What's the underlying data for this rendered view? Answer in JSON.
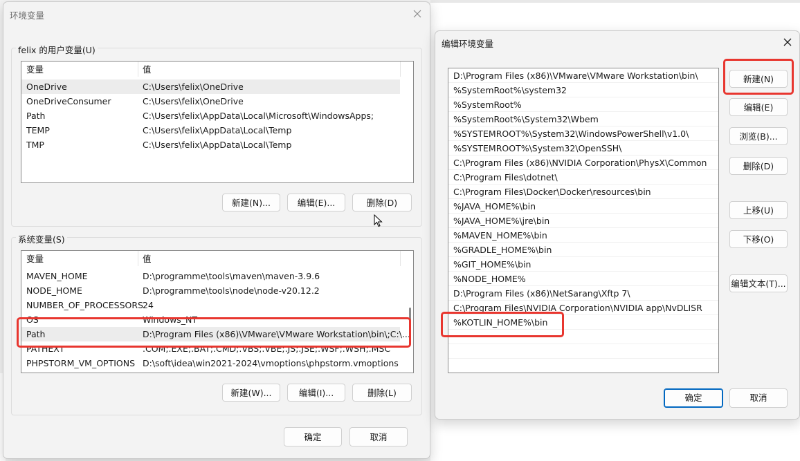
{
  "env_dialog": {
    "title": "环境变量",
    "user_group_label": "felix 的用户变量(U)",
    "user_columns": [
      "变量",
      "值"
    ],
    "user_vars": [
      {
        "name": "OneDrive",
        "value": "C:\\Users\\felix\\OneDrive"
      },
      {
        "name": "OneDriveConsumer",
        "value": "C:\\Users\\felix\\OneDrive"
      },
      {
        "name": "Path",
        "value": "C:\\Users\\felix\\AppData\\Local\\Microsoft\\WindowsApps;"
      },
      {
        "name": "TEMP",
        "value": "C:\\Users\\felix\\AppData\\Local\\Temp"
      },
      {
        "name": "TMP",
        "value": "C:\\Users\\felix\\AppData\\Local\\Temp"
      }
    ],
    "user_buttons": {
      "new": "新建(N)...",
      "edit": "编辑(E)...",
      "delete": "删除(D)"
    },
    "system_group_label": "系统变量(S)",
    "system_columns": [
      "变量",
      "值"
    ],
    "system_vars": [
      {
        "name": "MAVEN_HOME",
        "value": "D:\\programme\\tools\\maven\\maven-3.9.6"
      },
      {
        "name": "NODE_HOME",
        "value": "D:\\programme\\tools\\node\\node-v20.12.2"
      },
      {
        "name": "NUMBER_OF_PROCESSORS",
        "value": "24"
      },
      {
        "name": "OS",
        "value": "Windows_NT"
      },
      {
        "name": "Path",
        "value": "D:\\Program Files (x86)\\VMware\\VMware Workstation\\bin\\;C:\\..."
      },
      {
        "name": "PATHEXT",
        "value": ".COM;.EXE;.BAT;.CMD;.VBS;.VBE;.JS;.JSE;.WSF;.WSH;.MSC"
      },
      {
        "name": "PHPSTORM_VM_OPTIONS",
        "value": "D:\\soft\\idea\\win2021-2024\\vmoptions\\phpstorm.vmoptions"
      }
    ],
    "system_buttons": {
      "new": "新建(W)...",
      "edit": "编辑(I)...",
      "delete": "删除(L)"
    },
    "ok": "确定",
    "cancel": "取消"
  },
  "edit_dialog": {
    "title": "编辑环境变量",
    "paths": [
      "D:\\Program Files (x86)\\VMware\\VMware Workstation\\bin\\",
      "%SystemRoot%\\system32",
      "%SystemRoot%",
      "%SystemRoot%\\System32\\Wbem",
      "%SYSTEMROOT%\\System32\\WindowsPowerShell\\v1.0\\",
      "%SYSTEMROOT%\\System32\\OpenSSH\\",
      "C:\\Program Files (x86)\\NVIDIA Corporation\\PhysX\\Common",
      "C:\\Program Files\\dotnet\\",
      "C:\\Program Files\\Docker\\Docker\\resources\\bin",
      "%JAVA_HOME%\\bin",
      "%JAVA_HOME%\\jre\\bin",
      "%MAVEN_HOME%\\bin",
      "%GRADLE_HOME%\\bin",
      "%GIT_HOME%\\bin",
      "%NODE_HOME%",
      "D:\\Program Files (x86)\\NetSarang\\Xftp 7\\",
      "C:\\Program Files\\NVIDIA Corporation\\NVIDIA app\\NvDLISR",
      "%KOTLIN_HOME%\\bin"
    ],
    "buttons": {
      "new": "新建(N)",
      "edit": "编辑(E)",
      "browse": "浏览(B)...",
      "delete": "删除(D)",
      "move_up": "上移(U)",
      "move_down": "下移(O)",
      "edit_text": "编辑文本(T)..."
    },
    "ok": "确定",
    "cancel": "取消"
  },
  "colors": {
    "highlight_box": "#e8362f",
    "primary_border": "#0067c0"
  },
  "icons": {
    "close": "close-icon",
    "cursor": "mouse-cursor-icon"
  }
}
